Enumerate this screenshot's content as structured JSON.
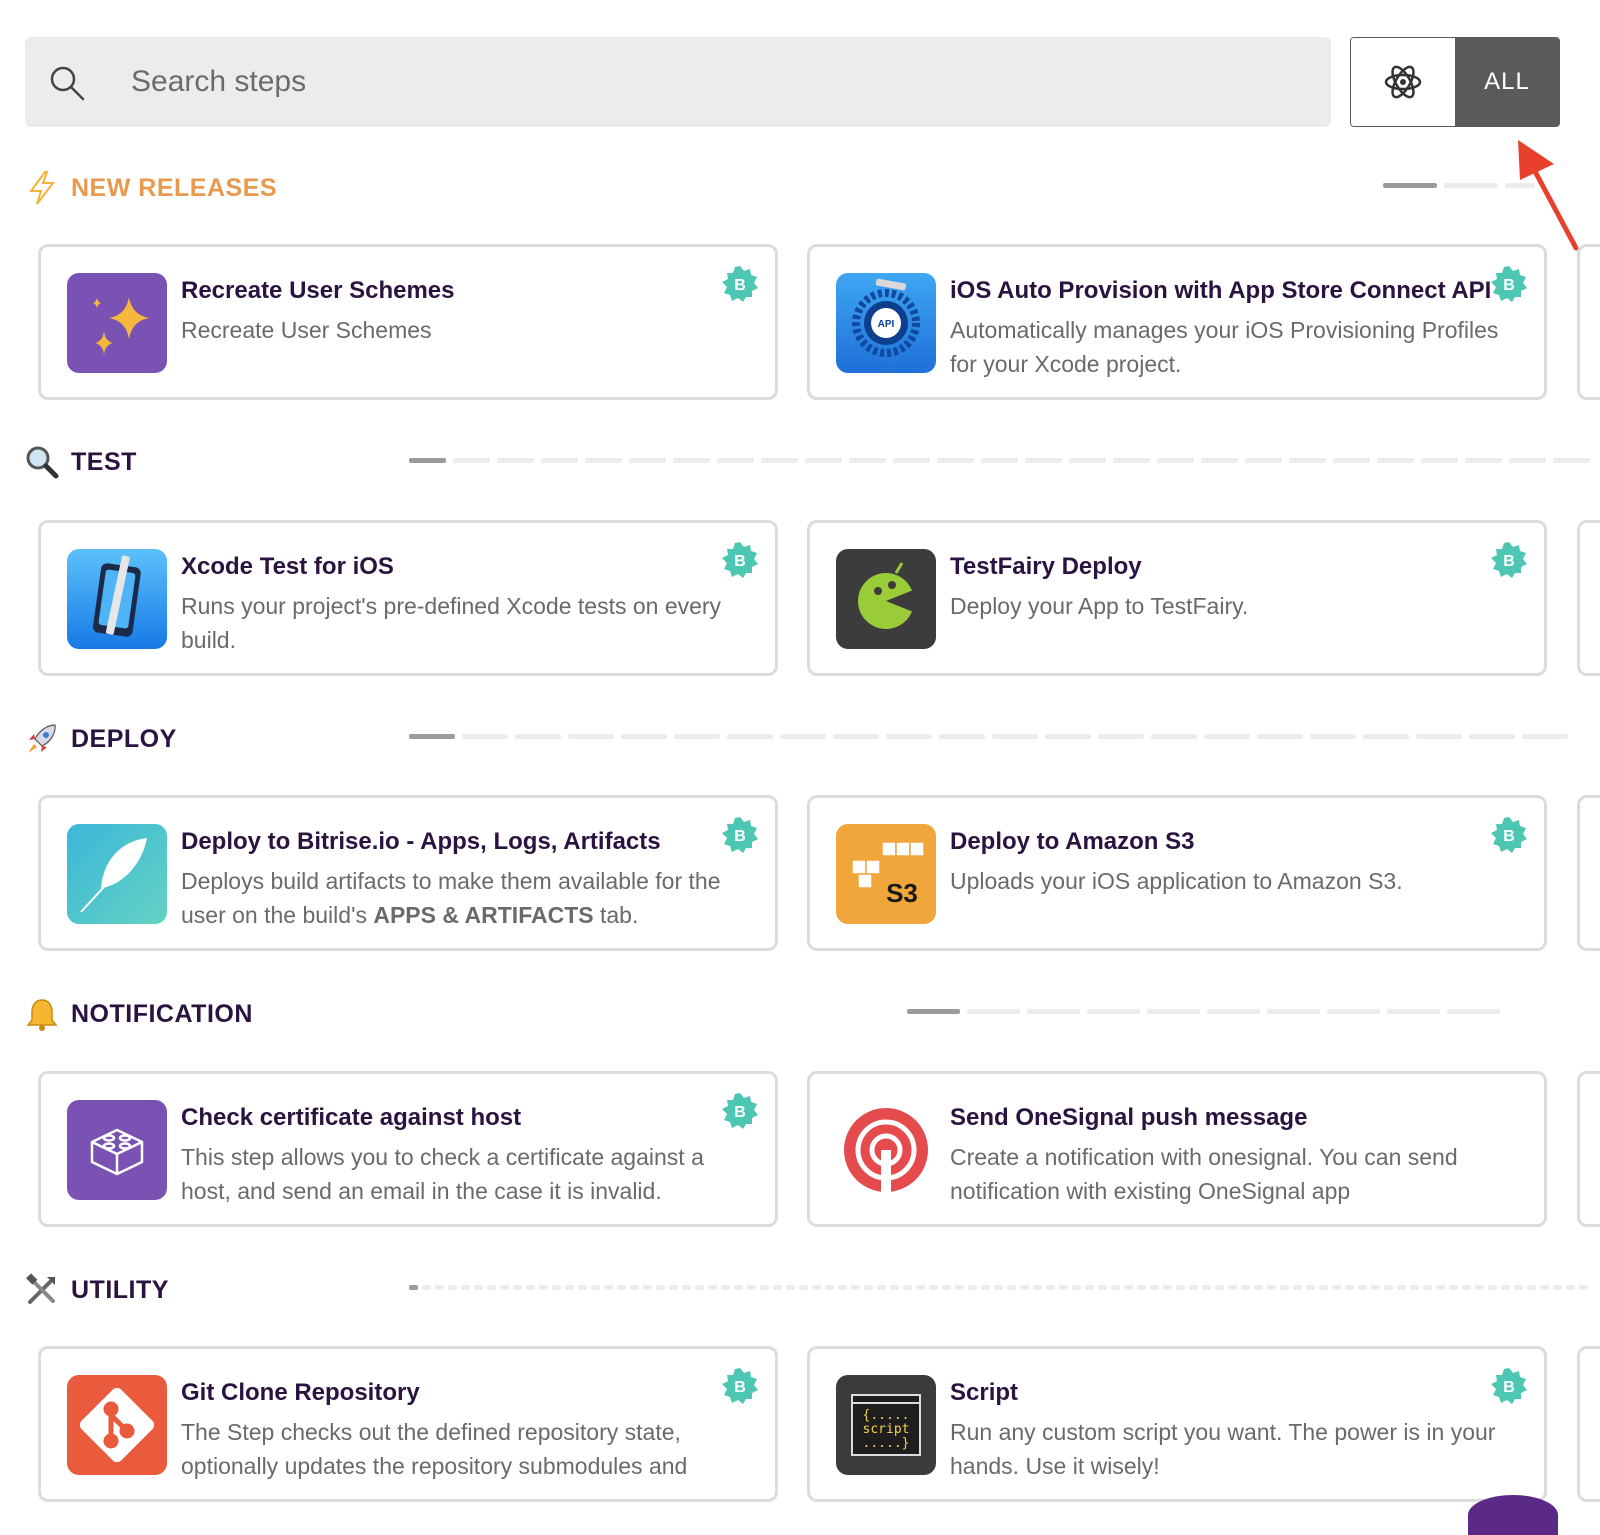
{
  "search": {
    "placeholder": "Search steps"
  },
  "filters": {
    "all_label": "ALL"
  },
  "colors": {
    "accent": "#e99a50",
    "badge": "#4ec6b4",
    "arrow": "#e8412b",
    "filter_dark": "#5a5a5a"
  },
  "sections": [
    {
      "title": "NEW RELEASES",
      "icon": "lightning-icon",
      "steps": [
        {
          "title": "Recreate User Schemes",
          "description": "Recreate User Schemes",
          "badge": "B",
          "icon": "sparkles-icon"
        },
        {
          "title": "iOS Auto Provision with App Store Connect API",
          "description": "Automatically manages your iOS Provisioning Profiles for your Xcode project.",
          "badge": "B",
          "icon": "api-gear-icon"
        }
      ]
    },
    {
      "title": "TEST",
      "icon": "magnifier-icon",
      "steps": [
        {
          "title": "Xcode Test for iOS",
          "description": "Runs your project's pre-defined Xcode tests on every build.",
          "badge": "B",
          "icon": "xcode-icon"
        },
        {
          "title": "TestFairy Deploy",
          "description": "Deploy your App to TestFairy.",
          "badge": "B",
          "icon": "testfairy-icon"
        }
      ]
    },
    {
      "title": "DEPLOY",
      "icon": "rocket-icon",
      "steps": [
        {
          "title": "Deploy to Bitrise.io - Apps, Logs, Artifacts",
          "description_prefix": "Deploys build artifacts to make them available for the user on the build's ",
          "description_bold": "APPS & ARTIFACTS",
          "description_suffix": " tab.",
          "badge": "B",
          "icon": "feather-icon"
        },
        {
          "title": "Deploy to Amazon S3",
          "description": "Uploads your iOS application to Amazon S3.",
          "badge": "B",
          "icon": "s3-icon",
          "icon_text": "S3"
        }
      ]
    },
    {
      "title": "NOTIFICATION",
      "icon": "bell-icon",
      "steps": [
        {
          "title": "Check certificate against host",
          "description": "This step allows you to check a certificate against a host, and send an email in the case it is invalid.",
          "badge": "B",
          "icon": "lego-brick-icon"
        },
        {
          "title": "Send OneSignal push message",
          "description": "Create a notification with onesignal. You can send notification with existing OneSignal app",
          "icon": "onesignal-icon"
        }
      ]
    },
    {
      "title": "UTILITY",
      "icon": "tools-icon",
      "steps": [
        {
          "title": "Git Clone Repository",
          "description": "The Step checks out the defined repository state, optionally updates the repository submodules and",
          "badge": "B",
          "icon": "git-icon"
        },
        {
          "title": "Script",
          "description": "Run any custom script you want. The power is in your hands. Use it wisely!",
          "badge": "B",
          "icon": "script-icon",
          "icon_lines": [
            "{.....",
            "script",
            ".....}"
          ]
        }
      ]
    }
  ]
}
